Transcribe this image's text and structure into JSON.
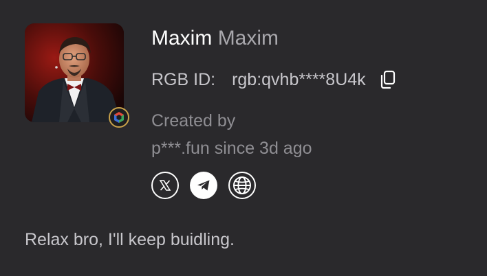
{
  "profile": {
    "first_name": "Maxim",
    "second_name": "Maxim",
    "rgb_label": "RGB ID:",
    "rgb_value": "rgb:qvhb****8U4k",
    "created_line1": "Created by",
    "created_line2": "p***.fun since 3d ago",
    "bio": "Relax bro, I'll keep buidling."
  },
  "icons": {
    "copy": "copy-icon",
    "x": "x-twitter-icon",
    "telegram": "telegram-icon",
    "website": "globe-icon",
    "badge": "verified-badge-icon"
  },
  "colors": {
    "background": "#2a292c",
    "name_primary": "#ffffff",
    "name_secondary": "#a9a8ad",
    "text": "#c7c6cb",
    "muted": "#8f8e93",
    "badge_ring": "#c9a24a"
  }
}
